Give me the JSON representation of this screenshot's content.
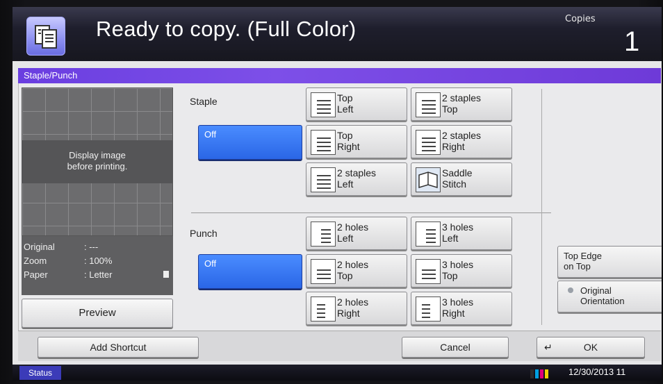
{
  "header": {
    "title": "Ready to copy. (Full Color)",
    "copies_label": "Copies",
    "copies_value": "1",
    "icon": "copy-icon"
  },
  "panel": {
    "title": "Staple/Punch",
    "preview_text_1": "Display image",
    "preview_text_2": "before printing.",
    "info": {
      "original_label": "Original",
      "original_value": ": ---",
      "zoom_label": "Zoom",
      "zoom_value": ": 100%",
      "paper_label": "Paper",
      "paper_value": ": Letter"
    },
    "preview_button": "Preview"
  },
  "staple": {
    "label": "Staple",
    "off": "Off",
    "options": [
      {
        "l1": "Top",
        "l2": "Left",
        "icon": "staple-top-left-icon"
      },
      {
        "l1": "2 staples",
        "l2": "Top",
        "icon": "staple-2-top-icon"
      },
      {
        "l1": "Top",
        "l2": "Right",
        "icon": "staple-top-right-icon"
      },
      {
        "l1": "2 staples",
        "l2": "Right",
        "icon": "staple-2-right-icon"
      },
      {
        "l1": "2 staples",
        "l2": "Left",
        "icon": "staple-2-left-icon"
      },
      {
        "l1": "Saddle",
        "l2": "Stitch",
        "icon": "saddle-stitch-icon"
      }
    ]
  },
  "punch": {
    "label": "Punch",
    "off": "Off",
    "options": [
      {
        "l1": "2 holes",
        "l2": "Left",
        "icon": "punch-2-left-icon"
      },
      {
        "l1": "3 holes",
        "l2": "Left",
        "icon": "punch-3-left-icon"
      },
      {
        "l1": "2 holes",
        "l2": "Top",
        "icon": "punch-2-top-icon"
      },
      {
        "l1": "3 holes",
        "l2": "Top",
        "icon": "punch-3-top-icon"
      },
      {
        "l1": "2 holes",
        "l2": "Right",
        "icon": "punch-2-right-icon"
      },
      {
        "l1": "3 holes",
        "l2": "Right",
        "icon": "punch-3-right-icon"
      }
    ]
  },
  "orientation": {
    "top_edge_1": "Top Edge",
    "top_edge_2": "on Top",
    "original_1": "Original",
    "original_2": "Orientation"
  },
  "footer": {
    "add_shortcut": "Add Shortcut",
    "cancel": "Cancel",
    "ok": "OK"
  },
  "status_bar": {
    "status": "Status",
    "datetime": "12/30/2013 11",
    "toner_colors": [
      "#2a2a2a",
      "#00a0e0",
      "#e0007a",
      "#f0d000"
    ]
  }
}
